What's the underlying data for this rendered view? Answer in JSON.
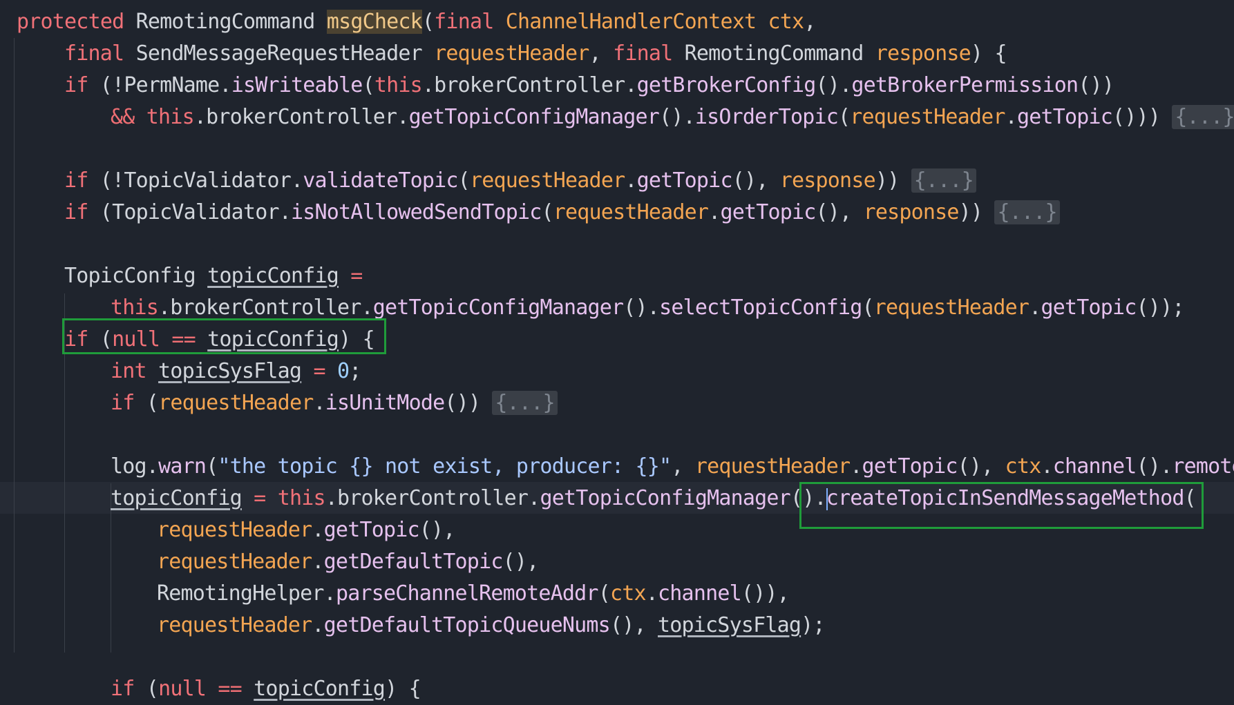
{
  "editor": {
    "lines": [
      {
        "indent": 0,
        "tokens": [
          {
            "t": "protected ",
            "c": "kw"
          },
          {
            "t": "RemotingCommand ",
            "c": "type"
          },
          {
            "t": "msgCheck",
            "c": "name-hl"
          },
          {
            "t": "(",
            "c": "plain"
          },
          {
            "t": "final ",
            "c": "kw"
          },
          {
            "t": "ChannelHandlerContext ",
            "c": "param"
          },
          {
            "t": "ctx",
            "c": "param"
          },
          {
            "t": ",",
            "c": "plain"
          }
        ]
      },
      {
        "indent": 1,
        "tokens": [
          {
            "t": "final ",
            "c": "kw"
          },
          {
            "t": "SendMessageRequestHeader ",
            "c": "type"
          },
          {
            "t": "requestHeader",
            "c": "param"
          },
          {
            "t": ", ",
            "c": "plain"
          },
          {
            "t": "final ",
            "c": "kw"
          },
          {
            "t": "RemotingCommand ",
            "c": "type"
          },
          {
            "t": "response",
            "c": "param"
          },
          {
            "t": ") {",
            "c": "plain"
          }
        ]
      },
      {
        "indent": 1,
        "tokens": [
          {
            "t": "if ",
            "c": "kw"
          },
          {
            "t": "(!",
            "c": "plain"
          },
          {
            "t": "PermName",
            "c": "type"
          },
          {
            "t": ".",
            "c": "plain"
          },
          {
            "t": "isWriteable",
            "c": "fn"
          },
          {
            "t": "(",
            "c": "plain"
          },
          {
            "t": "this",
            "c": "kw"
          },
          {
            "t": ".brokerController.",
            "c": "plain"
          },
          {
            "t": "getBrokerConfig",
            "c": "fn"
          },
          {
            "t": "().",
            "c": "plain"
          },
          {
            "t": "getBrokerPermission",
            "c": "fn"
          },
          {
            "t": "())",
            "c": "plain"
          }
        ]
      },
      {
        "indent": 2,
        "tokens": [
          {
            "t": "&& ",
            "c": "op"
          },
          {
            "t": "this",
            "c": "kw"
          },
          {
            "t": ".brokerController.",
            "c": "plain"
          },
          {
            "t": "getTopicConfigManager",
            "c": "fn"
          },
          {
            "t": "().",
            "c": "plain"
          },
          {
            "t": "isOrderTopic",
            "c": "fn"
          },
          {
            "t": "(",
            "c": "plain"
          },
          {
            "t": "requestHeader",
            "c": "param"
          },
          {
            "t": ".",
            "c": "plain"
          },
          {
            "t": "getTopic",
            "c": "fn"
          },
          {
            "t": "())) ",
            "c": "plain"
          },
          {
            "t": "{...}",
            "c": "fold"
          }
        ]
      },
      {
        "indent": 0,
        "tokens": []
      },
      {
        "indent": 1,
        "tokens": [
          {
            "t": "if ",
            "c": "kw"
          },
          {
            "t": "(!",
            "c": "plain"
          },
          {
            "t": "TopicValidator",
            "c": "type"
          },
          {
            "t": ".",
            "c": "plain"
          },
          {
            "t": "validateTopic",
            "c": "fn"
          },
          {
            "t": "(",
            "c": "plain"
          },
          {
            "t": "requestHeader",
            "c": "param"
          },
          {
            "t": ".",
            "c": "plain"
          },
          {
            "t": "getTopic",
            "c": "fn"
          },
          {
            "t": "(), ",
            "c": "plain"
          },
          {
            "t": "response",
            "c": "param"
          },
          {
            "t": ")) ",
            "c": "plain"
          },
          {
            "t": "{...}",
            "c": "fold"
          }
        ]
      },
      {
        "indent": 1,
        "tokens": [
          {
            "t": "if ",
            "c": "kw"
          },
          {
            "t": "(",
            "c": "plain"
          },
          {
            "t": "TopicValidator",
            "c": "type"
          },
          {
            "t": ".",
            "c": "plain"
          },
          {
            "t": "isNotAllowedSendTopic",
            "c": "fn"
          },
          {
            "t": "(",
            "c": "plain"
          },
          {
            "t": "requestHeader",
            "c": "param"
          },
          {
            "t": ".",
            "c": "plain"
          },
          {
            "t": "getTopic",
            "c": "fn"
          },
          {
            "t": "(), ",
            "c": "plain"
          },
          {
            "t": "response",
            "c": "param"
          },
          {
            "t": ")) ",
            "c": "plain"
          },
          {
            "t": "{...}",
            "c": "fold"
          }
        ]
      },
      {
        "indent": 0,
        "tokens": []
      },
      {
        "indent": 1,
        "tokens": [
          {
            "t": "TopicConfig ",
            "c": "type"
          },
          {
            "t": "topicConfig",
            "c": "u"
          },
          {
            "t": " =",
            "c": "op"
          }
        ]
      },
      {
        "indent": 2,
        "tokens": [
          {
            "t": "this",
            "c": "kw"
          },
          {
            "t": ".brokerController.",
            "c": "plain"
          },
          {
            "t": "getTopicConfigManager",
            "c": "fn"
          },
          {
            "t": "().",
            "c": "plain"
          },
          {
            "t": "selectTopicConfig",
            "c": "fn"
          },
          {
            "t": "(",
            "c": "plain"
          },
          {
            "t": "requestHeader",
            "c": "param"
          },
          {
            "t": ".",
            "c": "plain"
          },
          {
            "t": "getTopic",
            "c": "fn"
          },
          {
            "t": "());",
            "c": "plain"
          }
        ]
      },
      {
        "indent": 1,
        "tokens": [
          {
            "t": "if ",
            "c": "kw"
          },
          {
            "t": "(",
            "c": "plain"
          },
          {
            "t": "null ",
            "c": "kw"
          },
          {
            "t": "== ",
            "c": "op"
          },
          {
            "t": "topicConfig",
            "c": "u"
          },
          {
            "t": ") {",
            "c": "plain"
          }
        ]
      },
      {
        "indent": 2,
        "tokens": [
          {
            "t": "int ",
            "c": "kw"
          },
          {
            "t": "topicSysFlag",
            "c": "u"
          },
          {
            "t": " = ",
            "c": "op"
          },
          {
            "t": "0",
            "c": "num"
          },
          {
            "t": ";",
            "c": "plain"
          }
        ]
      },
      {
        "indent": 2,
        "tokens": [
          {
            "t": "if ",
            "c": "kw"
          },
          {
            "t": "(",
            "c": "plain"
          },
          {
            "t": "requestHeader",
            "c": "param"
          },
          {
            "t": ".",
            "c": "plain"
          },
          {
            "t": "isUnitMode",
            "c": "fn"
          },
          {
            "t": "()) ",
            "c": "plain"
          },
          {
            "t": "{...}",
            "c": "fold"
          }
        ]
      },
      {
        "indent": 0,
        "tokens": []
      },
      {
        "indent": 2,
        "tokens": [
          {
            "t": "log",
            "c": "type"
          },
          {
            "t": ".",
            "c": "plain"
          },
          {
            "t": "warn",
            "c": "fn"
          },
          {
            "t": "(",
            "c": "plain"
          },
          {
            "t": "\"the topic {} not exist, producer: {}\"",
            "c": "str"
          },
          {
            "t": ", ",
            "c": "plain"
          },
          {
            "t": "requestHeader",
            "c": "param"
          },
          {
            "t": ".",
            "c": "plain"
          },
          {
            "t": "getTopic",
            "c": "fn"
          },
          {
            "t": "(), ",
            "c": "plain"
          },
          {
            "t": "ctx",
            "c": "param"
          },
          {
            "t": ".",
            "c": "plain"
          },
          {
            "t": "channel",
            "c": "fn"
          },
          {
            "t": "().",
            "c": "plain"
          },
          {
            "t": "remoteAd",
            "c": "fn"
          }
        ]
      },
      {
        "indent": 2,
        "tokens": [
          {
            "t": "topicConfig",
            "c": "u"
          },
          {
            "t": " = ",
            "c": "op"
          },
          {
            "t": "this",
            "c": "kw"
          },
          {
            "t": ".brokerController.",
            "c": "plain"
          },
          {
            "t": "getTopicConfigManager",
            "c": "fn"
          },
          {
            "t": "().",
            "c": "plain"
          },
          {
            "t": "caret",
            "c": "caret"
          },
          {
            "t": "createTopicInSendMessageMethod",
            "c": "fn"
          },
          {
            "t": "(",
            "c": "plain"
          }
        ]
      },
      {
        "indent": 3,
        "tokens": [
          {
            "t": "requestHeader",
            "c": "param"
          },
          {
            "t": ".",
            "c": "plain"
          },
          {
            "t": "getTopic",
            "c": "fn"
          },
          {
            "t": "(),",
            "c": "plain"
          }
        ]
      },
      {
        "indent": 3,
        "tokens": [
          {
            "t": "requestHeader",
            "c": "param"
          },
          {
            "t": ".",
            "c": "plain"
          },
          {
            "t": "getDefaultTopic",
            "c": "fn"
          },
          {
            "t": "(),",
            "c": "plain"
          }
        ]
      },
      {
        "indent": 3,
        "tokens": [
          {
            "t": "RemotingHelper",
            "c": "type"
          },
          {
            "t": ".",
            "c": "plain"
          },
          {
            "t": "parseChannelRemoteAddr",
            "c": "fn"
          },
          {
            "t": "(",
            "c": "plain"
          },
          {
            "t": "ctx",
            "c": "param"
          },
          {
            "t": ".",
            "c": "plain"
          },
          {
            "t": "channel",
            "c": "fn"
          },
          {
            "t": "()),",
            "c": "plain"
          }
        ]
      },
      {
        "indent": 3,
        "tokens": [
          {
            "t": "requestHeader",
            "c": "param"
          },
          {
            "t": ".",
            "c": "plain"
          },
          {
            "t": "getDefaultTopicQueueNums",
            "c": "fn"
          },
          {
            "t": "(), ",
            "c": "plain"
          },
          {
            "t": "topicSysFlag",
            "c": "u"
          },
          {
            "t": ");",
            "c": "plain"
          }
        ]
      },
      {
        "indent": 0,
        "tokens": []
      },
      {
        "indent": 2,
        "tokens": [
          {
            "t": "if ",
            "c": "kw"
          },
          {
            "t": "(",
            "c": "plain"
          },
          {
            "t": "null ",
            "c": "kw"
          },
          {
            "t": "== ",
            "c": "op"
          },
          {
            "t": "topicConfig",
            "c": "u"
          },
          {
            "t": ") {",
            "c": "plain"
          }
        ]
      }
    ],
    "highlight_color": "#1f9c3a"
  }
}
